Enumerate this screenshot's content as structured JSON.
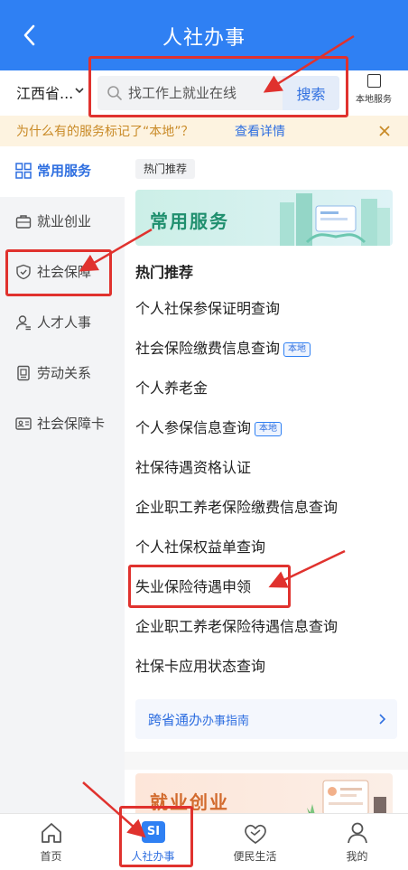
{
  "header": {
    "title": "人社办事"
  },
  "search": {
    "region": "江西省...",
    "placeholder": "找工作上就业在线",
    "button_label": "搜索",
    "local_service_label": "本地服务"
  },
  "notice": {
    "text": "为什么有的服务标记了“本地”？",
    "link": "查看详情"
  },
  "sidebar": {
    "items": [
      {
        "label": "常用服务",
        "icon": "grid-icon",
        "active": true
      },
      {
        "label": "就业创业",
        "icon": "briefcase-icon",
        "active": false
      },
      {
        "label": "社会保障",
        "icon": "shield-icon",
        "active": false
      },
      {
        "label": "人才人事",
        "icon": "person-icon",
        "active": false
      },
      {
        "label": "劳动关系",
        "icon": "document-icon",
        "active": false
      },
      {
        "label": "社会保障卡",
        "icon": "id-card-icon",
        "active": false
      }
    ]
  },
  "main": {
    "tag": "热门推荐",
    "banner_title": "常用服务",
    "section_title": "热门推荐",
    "services": [
      {
        "label": "个人社保参保证明查询",
        "badge": ""
      },
      {
        "label": "社会保险缴费信息查询",
        "badge": "本地"
      },
      {
        "label": "个人养老金",
        "badge": ""
      },
      {
        "label": "个人参保信息查询",
        "badge": "本地"
      },
      {
        "label": "社保待遇资格认证",
        "badge": ""
      },
      {
        "label": "企业职工养老保险缴费信息查询",
        "badge": ""
      },
      {
        "label": "个人社保权益单查询",
        "badge": ""
      },
      {
        "label": "失业保险待遇申领",
        "badge": ""
      },
      {
        "label": "企业职工养老保险待遇信息查询",
        "badge": ""
      },
      {
        "label": "社保卡应用状态查询",
        "badge": ""
      }
    ],
    "guide": {
      "prefix": "跨省通办",
      "suffix": "办事指南"
    },
    "banner2_title": "就业创业"
  },
  "tabbar": {
    "items": [
      {
        "label": "首页",
        "icon": "home-icon",
        "active": false
      },
      {
        "label": "人社办事",
        "icon": "si-icon",
        "icon_text": "SI",
        "active": true
      },
      {
        "label": "便民生活",
        "icon": "handshake-icon",
        "active": false
      },
      {
        "label": "我的",
        "icon": "user-icon",
        "active": false
      }
    ]
  },
  "colors": {
    "primary": "#2f80f3",
    "annotation_red": "#e0322e",
    "notice_bg": "#fdf3e0",
    "notice_text": "#c98a26"
  }
}
